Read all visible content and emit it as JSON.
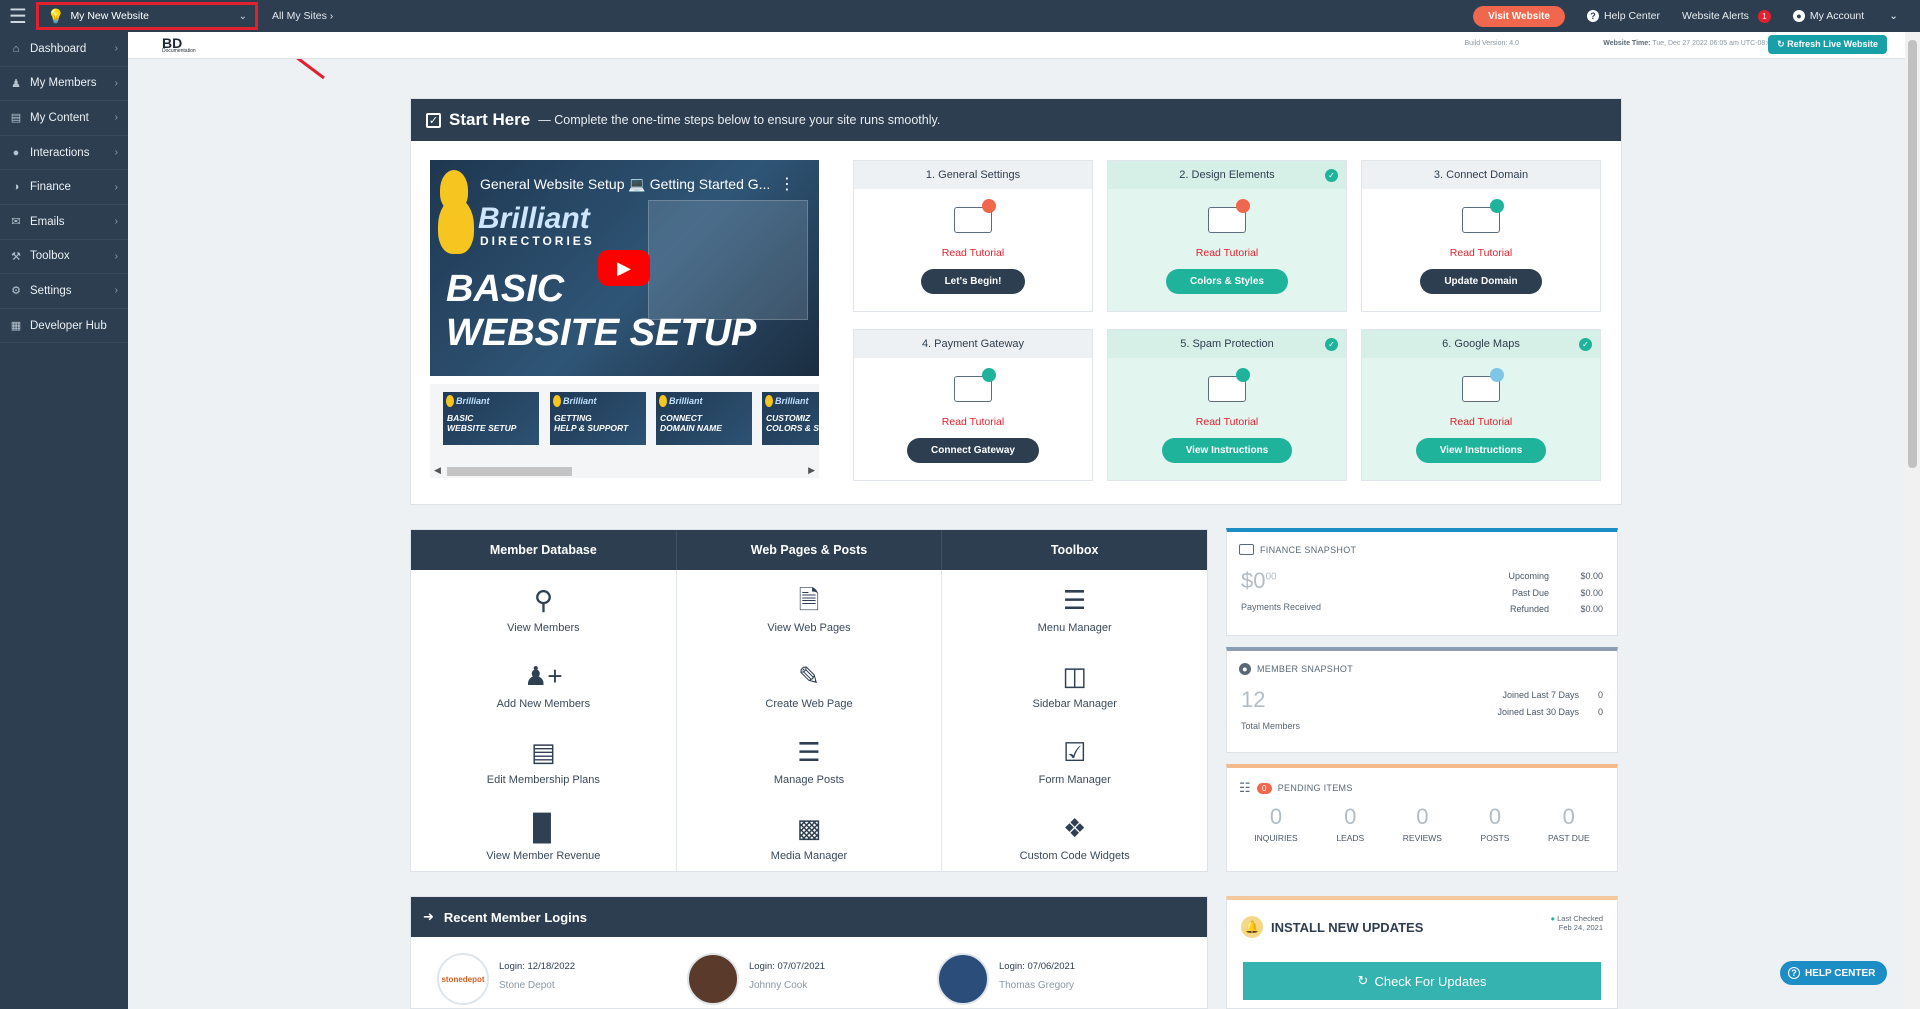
{
  "topbar": {
    "site_name": "My New Website",
    "all_sites": "All My Sites",
    "visit_website": "Visit Website",
    "help_center": "Help Center",
    "website_alerts": "Website Alerts",
    "alerts_count": "1",
    "my_account": "My Account"
  },
  "sidebar": {
    "items": [
      {
        "label": "Dashboard",
        "icon": "home-icon"
      },
      {
        "label": "My Members",
        "icon": "users-icon"
      },
      {
        "label": "My Content",
        "icon": "folder-icon"
      },
      {
        "label": "Interactions",
        "icon": "comments-icon"
      },
      {
        "label": "Finance",
        "icon": "chart-pie-icon"
      },
      {
        "label": "Emails",
        "icon": "envelope-icon"
      },
      {
        "label": "Toolbox",
        "icon": "wrench-icon"
      },
      {
        "label": "Settings",
        "icon": "gear-icon"
      },
      {
        "label": "Developer Hub",
        "icon": "grid-icon"
      }
    ]
  },
  "subheader": {
    "logo_text": "BD",
    "logo_sub": "Documentation",
    "build_version": "Build Version: 4.0",
    "website_time_label": "Website Time:",
    "website_time_value": "Tue, Dec 27 2022 06:05 am UTC-08:00",
    "refresh_label": "Refresh Live Website"
  },
  "start_here": {
    "title": "Start Here",
    "subtitle": "— Complete the one-time steps below to ensure your site runs smoothly.",
    "video": {
      "title": "General Website Setup 💻 Getting Started G...",
      "brand": "Brilliant",
      "brand_sub": "DIRECTORIES",
      "line1": "BASIC",
      "line2": "WEBSITE SETUP"
    },
    "thumbnails": [
      {
        "brand": "Brilliant",
        "line1": "BASIC",
        "line2": "WEBSITE SETUP"
      },
      {
        "brand": "Brilliant",
        "line1": "GETTING",
        "line2": "HELP & SUPPORT"
      },
      {
        "brand": "Brilliant",
        "line1": "CONNECT",
        "line2": "DOMAIN NAME"
      },
      {
        "brand": "Brilliant",
        "line1": "CUSTOMIZ",
        "line2": "COLORS & S"
      }
    ],
    "read_tutorial": "Read Tutorial",
    "steps": [
      {
        "title": "1. General Settings",
        "link": "Read Tutorial",
        "button": "Let's Begin!",
        "done": false
      },
      {
        "title": "2. Design Elements",
        "link": "Read Tutorial",
        "button": "Colors & Styles",
        "done": true
      },
      {
        "title": "3. Connect Domain",
        "link": "Read Tutorial",
        "button": "Update Domain",
        "done": false
      },
      {
        "title": "4. Payment Gateway",
        "link": "Read Tutorial",
        "button": "Connect Gateway",
        "done": false
      },
      {
        "title": "5. Spam Protection",
        "link": "Read Tutorial",
        "button": "View Instructions",
        "done": true
      },
      {
        "title": "6. Google Maps",
        "link": "Read Tutorial",
        "button": "View Instructions",
        "done": true
      }
    ]
  },
  "quick_links": {
    "columns": [
      {
        "title": "Member Database",
        "items": [
          {
            "label": "View Members",
            "icon": "search-plus-icon"
          },
          {
            "label": "Add New Members",
            "icon": "user-plus-icon"
          },
          {
            "label": "Edit Membership Plans",
            "icon": "id-card-icon"
          },
          {
            "label": "View Member Revenue",
            "icon": "bar-chart-icon"
          }
        ]
      },
      {
        "title": "Web Pages & Posts",
        "items": [
          {
            "label": "View Web Pages",
            "icon": "file-icon"
          },
          {
            "label": "Create Web Page",
            "icon": "edit-icon"
          },
          {
            "label": "Manage Posts",
            "icon": "list-alt-icon"
          },
          {
            "label": "Media Manager",
            "icon": "image-icon"
          }
        ]
      },
      {
        "title": "Toolbox",
        "items": [
          {
            "label": "Menu Manager",
            "icon": "list-icon"
          },
          {
            "label": "Sidebar Manager",
            "icon": "columns-icon"
          },
          {
            "label": "Form Manager",
            "icon": "check-square-icon"
          },
          {
            "label": "Custom Code Widgets",
            "icon": "cubes-icon"
          }
        ]
      }
    ]
  },
  "finance": {
    "title": "FINANCE SNAPSHOT",
    "amount": "$0",
    "cents": "00",
    "caption": "Payments Received",
    "rows": [
      {
        "label": "Upcoming",
        "value": "$0.00"
      },
      {
        "label": "Past Due",
        "value": "$0.00"
      },
      {
        "label": "Refunded",
        "value": "$0.00"
      }
    ]
  },
  "members_snap": {
    "title": "MEMBER SNAPSHOT",
    "total": "12",
    "caption": "Total Members",
    "rows": [
      {
        "label": "Joined Last 7 Days",
        "value": "0"
      },
      {
        "label": "Joined Last 30 Days",
        "value": "0"
      }
    ]
  },
  "pending": {
    "badge": "0",
    "title": "PENDING ITEMS",
    "items": [
      {
        "value": "0",
        "label": "INQUIRIES"
      },
      {
        "value": "0",
        "label": "LEADS"
      },
      {
        "value": "0",
        "label": "REVIEWS"
      },
      {
        "value": "0",
        "label": "POSTS"
      },
      {
        "value": "0",
        "label": "PAST DUE"
      }
    ]
  },
  "logins": {
    "title": "Recent Member Logins",
    "items": [
      {
        "date": "Login: 12/18/2022",
        "name": "Stone Depot",
        "avatar": "stonedepot"
      },
      {
        "date": "Login: 07/07/2021",
        "name": "Johnny Cook",
        "avatar": ""
      },
      {
        "date": "Login: 07/06/2021",
        "name": "Thomas Gregory",
        "avatar": ""
      }
    ]
  },
  "updates": {
    "title": "INSTALL NEW UPDATES",
    "last_checked_label": "Last Checked",
    "last_checked_date": "Feb 24, 2021",
    "button": "Check For Updates"
  },
  "help_float": "HELP CENTER",
  "colors": {
    "navy": "#2c3e50",
    "teal": "#1fb39b",
    "accent_orange": "#f0674d",
    "alert_red": "#e1212e",
    "blue": "#1c8dc5"
  }
}
